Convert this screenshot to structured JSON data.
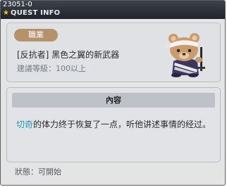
{
  "window": {
    "quest_id": "23051-0",
    "title_star": "★",
    "title": "QUEST INFO"
  },
  "header": {
    "job_label": "職業",
    "quest_name": "[反抗者] 黑色之翼的新武器",
    "level_requirement": "建議等級：100以上",
    "npc_image": "bear-npc-portrait"
  },
  "content": {
    "header_label": "內容",
    "npc_name": "切奇",
    "description_rest": "的体力终于恢复了一点，听他讲述事情的经过。"
  },
  "status": {
    "text": "狀態：可開始"
  },
  "colors": {
    "titlebar": "#2a2f36",
    "title_star": "#f1c800",
    "job_badge": "#b6926b",
    "npc_name": "#1f97b6",
    "content_header": "#bdc2c8"
  }
}
